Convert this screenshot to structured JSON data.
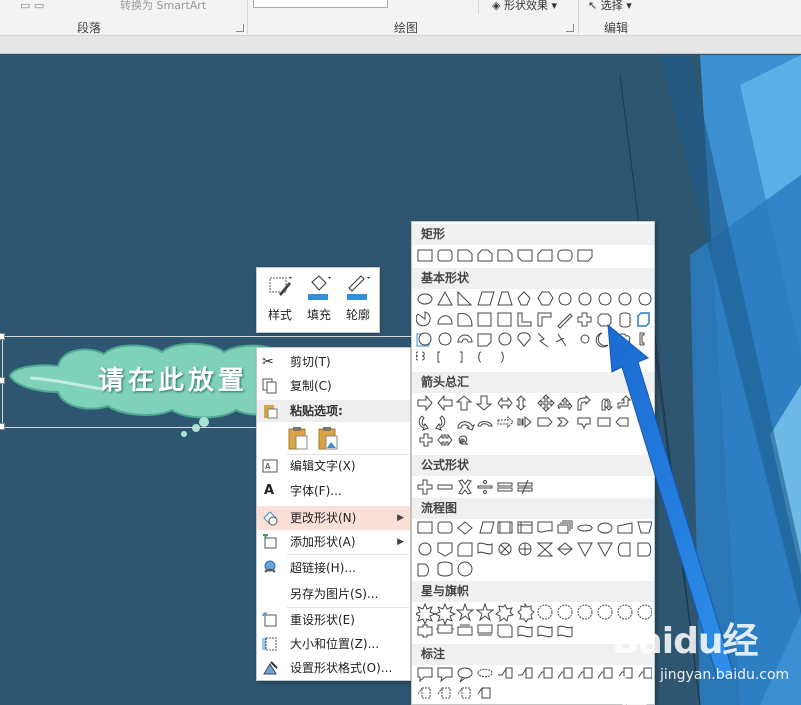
{
  "ribbon": {
    "convert_smartart": "转换为 SmartArt",
    "shape_effects": "形状效果",
    "select": "选择",
    "groups": [
      "段落",
      "绘图",
      "编辑"
    ]
  },
  "slide": {
    "placeholder_text": "请在此放置",
    "colors": {
      "background": "#2f5670",
      "accent_blue": "#2f8fd8",
      "cloud": "#7fd1b9"
    }
  },
  "mini_toolbar": {
    "style_label": "样式",
    "fill_label": "填充",
    "outline_label": "轮廓"
  },
  "context_menu": {
    "cut": "剪切(T)",
    "copy": "复制(C)",
    "paste_options": "粘贴选项:",
    "edit_text": "编辑文字(X)",
    "font": "字体(F)...",
    "change_shape": "更改形状(N)",
    "add_shape": "添加形状(A)",
    "hyperlink": "超链接(H)...",
    "save_as_picture": "另存为图片(S)...",
    "reset_shape": "重设形状(E)",
    "size_position": "大小和位置(Z)...",
    "format_shape": "设置形状格式(O)..."
  },
  "shapes_gallery": {
    "categories": [
      "矩形",
      "基本形状",
      "箭头总汇",
      "公式形状",
      "流程图",
      "星与旗帜",
      "标注"
    ]
  },
  "watermark": {
    "brand": "Baidu经验",
    "url": "jingyan.baidu.com"
  }
}
